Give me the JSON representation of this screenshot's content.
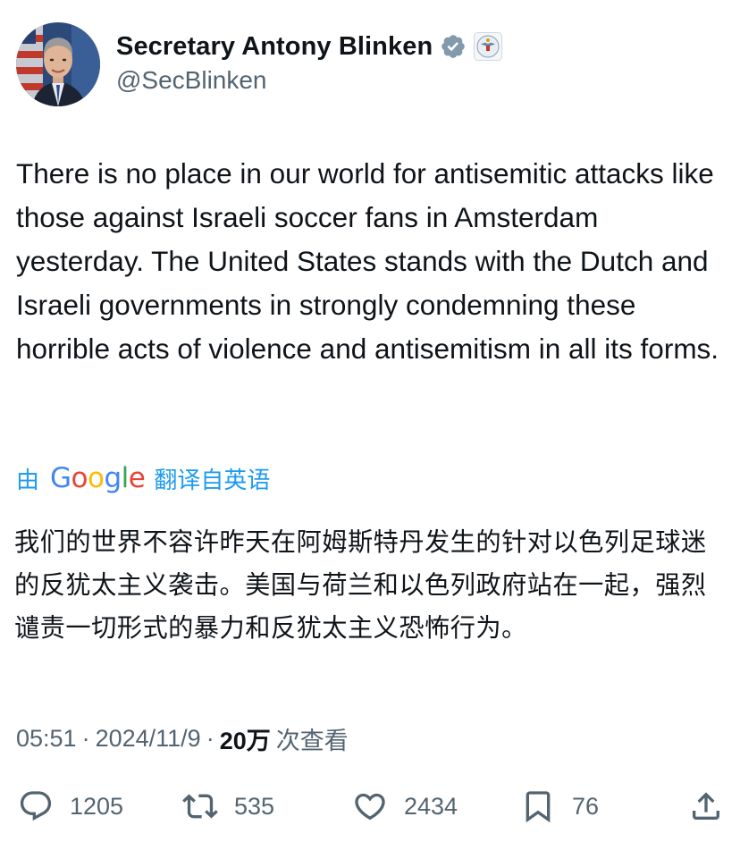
{
  "author": {
    "display_name": "Secretary Antony Blinken",
    "handle": "@SecBlinken",
    "verified_icon": "verified-badge-icon",
    "affiliation_icon": "state-department-seal-icon"
  },
  "tweet": {
    "text": "There is no place in our world for antisemitic attacks like those against Israeli soccer fans in Amsterdam yesterday. The United States stands with the Dutch and Israeli governments in strongly condemning these horrible acts of violence and antisemitism in all its forms.",
    "translated_text": "我们的世界不容许昨天在阿姆斯特丹发生的针对以色列足球迷的反犹太主义袭击。美国与荷兰和以色列政府站在一起，强烈谴责一切形式的暴力和反犹太主义恐怖行为。"
  },
  "translation": {
    "prefix": "由",
    "provider_letters": [
      "G",
      "o",
      "o",
      "g",
      "l",
      "e"
    ],
    "suffix": "翻译自英语"
  },
  "meta": {
    "time": "05:51",
    "date": "2024/11/9",
    "separator": "·",
    "views_count": "20万",
    "views_label": "次查看"
  },
  "actions": {
    "replies": "1205",
    "reposts": "535",
    "likes": "2434",
    "bookmarks": "76"
  },
  "colors": {
    "link_blue": "#1d9bf0",
    "secondary_text": "#536471",
    "primary_text": "#0f1419",
    "verified_gray": "#829aab"
  }
}
